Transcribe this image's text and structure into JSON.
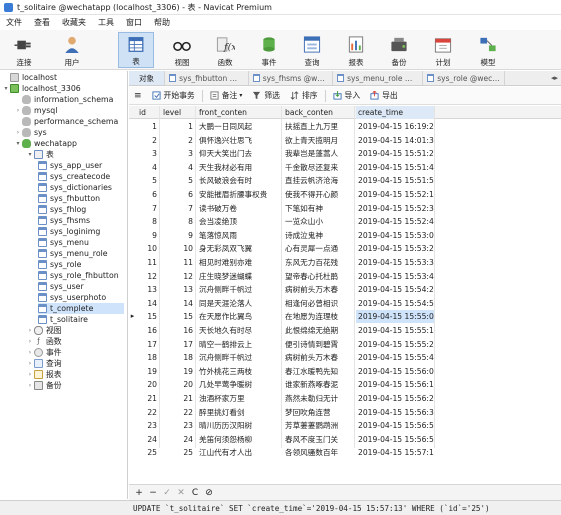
{
  "window": {
    "title": "t_solitaire @wechatapp (localhost_3306) - 表 - Navicat Premium"
  },
  "menu": [
    "文件",
    "查看",
    "收藏夹",
    "工具",
    "窗口",
    "帮助"
  ],
  "toolbar": {
    "buttons": [
      {
        "label": "连接",
        "icon": "plug-icon"
      },
      {
        "label": "用户",
        "icon": "user-icon"
      },
      {
        "label": "表",
        "icon": "table-icon"
      },
      {
        "label": "视图",
        "icon": "glasses-icon"
      },
      {
        "label": "函数",
        "icon": "function-icon"
      },
      {
        "label": "事件",
        "icon": "event-icon"
      },
      {
        "label": "查询",
        "icon": "query-icon"
      },
      {
        "label": "报表",
        "icon": "report-icon"
      },
      {
        "label": "备份",
        "icon": "backup-icon"
      },
      {
        "label": "计划",
        "icon": "calendar-icon"
      },
      {
        "label": "模型",
        "icon": "model-icon"
      }
    ],
    "active": "表"
  },
  "sidebar": {
    "items": [
      {
        "label": "localhost",
        "icon": "server",
        "twisty": ""
      },
      {
        "label": "localhost_3306",
        "icon": "server-on",
        "twisty": "▾"
      },
      {
        "label": "information_schema",
        "icon": "db",
        "twisty": ""
      },
      {
        "label": "mysql",
        "icon": "db",
        "twisty": "›"
      },
      {
        "label": "performance_schema",
        "icon": "db",
        "twisty": ""
      },
      {
        "label": "sys",
        "icon": "db",
        "twisty": "›"
      },
      {
        "label": "wechatapp",
        "icon": "db-on",
        "twisty": "▾"
      },
      {
        "label": "表",
        "icon": "tables",
        "twisty": "▾"
      },
      {
        "label": "sys_app_user",
        "icon": "table",
        "twisty": ""
      },
      {
        "label": "sys_createcode",
        "icon": "table",
        "twisty": ""
      },
      {
        "label": "sys_dictionaries",
        "icon": "table",
        "twisty": ""
      },
      {
        "label": "sys_fhbutton",
        "icon": "table",
        "twisty": ""
      },
      {
        "label": "sys_fhlog",
        "icon": "table",
        "twisty": ""
      },
      {
        "label": "sys_fhsms",
        "icon": "table",
        "twisty": ""
      },
      {
        "label": "sys_loginimg",
        "icon": "table",
        "twisty": ""
      },
      {
        "label": "sys_menu",
        "icon": "table",
        "twisty": ""
      },
      {
        "label": "sys_menu_role",
        "icon": "table",
        "twisty": ""
      },
      {
        "label": "sys_role",
        "icon": "table",
        "twisty": ""
      },
      {
        "label": "sys_role_fhbutton",
        "icon": "table",
        "twisty": ""
      },
      {
        "label": "sys_user",
        "icon": "table",
        "twisty": ""
      },
      {
        "label": "sys_userphoto",
        "icon": "table",
        "twisty": ""
      },
      {
        "label": "t_complete",
        "icon": "table",
        "twisty": "",
        "selected": true
      },
      {
        "label": "t_solitaire",
        "icon": "table",
        "twisty": ""
      },
      {
        "label": "视图",
        "icon": "view",
        "twisty": "›"
      },
      {
        "label": "函数",
        "icon": "func",
        "twisty": "›"
      },
      {
        "label": "事件",
        "icon": "event",
        "twisty": "›"
      },
      {
        "label": "查询",
        "icon": "query",
        "twisty": "›"
      },
      {
        "label": "报表",
        "icon": "report",
        "twisty": "›"
      },
      {
        "label": "备份",
        "icon": "backup",
        "twisty": "›"
      }
    ]
  },
  "tabs": [
    {
      "label": "对象"
    },
    {
      "label": "sys_fhbutton @we..."
    },
    {
      "label": "sys_fhsms @wechat..."
    },
    {
      "label": "sys_menu_role @we..."
    },
    {
      "label": "sys_role @wecha..."
    }
  ],
  "grid_toolbar": {
    "begin_transaction": "开始事务",
    "memo": "备注",
    "filter": "筛选",
    "sort": "排序",
    "import": "导入",
    "export": "导出"
  },
  "table": {
    "columns": [
      "id",
      "level",
      "front_conten",
      "back_conten",
      "create_time"
    ],
    "current_row_index": 14,
    "rows": [
      [
        "1",
        "1",
        "大鹏一日同风起",
        "扶摇直上九万里",
        "2019-04-15 16:19:21"
      ],
      [
        "2",
        "2",
        "俱怀逸兴壮思飞",
        "欲上青天揽明月",
        "2019-04-15 14:01:38"
      ],
      [
        "3",
        "3",
        "仰天大笑出门去",
        "我辈岂是蓬蒿人",
        "2019-04-15 15:51:29"
      ],
      [
        "4",
        "4",
        "天生我材必有用",
        "千金散尽还复来",
        "2019-04-15 15:51:49"
      ],
      [
        "5",
        "5",
        "长风破浪会有时",
        "直挂云帆济沧海",
        "2019-04-15 15:51:51"
      ],
      [
        "6",
        "6",
        "安能摧眉折腰事权贵",
        "使我不得开心颜",
        "2019-04-15 15:52:18"
      ],
      [
        "7",
        "7",
        "读书破万卷",
        "下笔如有神",
        "2019-04-15 15:52:30"
      ],
      [
        "8",
        "8",
        "会当凌绝顶",
        "一览众山小",
        "2019-04-15 15:52:49"
      ],
      [
        "9",
        "9",
        "笔落惊风雨",
        "诗成泣鬼神",
        "2019-04-15 15:53:01"
      ],
      [
        "10",
        "10",
        "身无彩凤双飞翼",
        "心有灵犀一点通",
        "2019-04-15 15:53:23"
      ],
      [
        "11",
        "11",
        "相见时难别亦难",
        "东风无力百花残",
        "2019-04-15 15:53:34"
      ],
      [
        "12",
        "12",
        "庄生晓梦迷蝴蝶",
        "望帝春心托杜鹃",
        "2019-04-15 15:53:45"
      ],
      [
        "13",
        "13",
        "沉舟侧畔千帆过",
        "病树前头万木春",
        "2019-04-15 15:54:23"
      ],
      [
        "14",
        "14",
        "同是天涯沦落人",
        "相逢何必曾相识",
        "2019-04-15 15:54:56"
      ],
      [
        "15",
        "15",
        "在天愿作比翼鸟",
        "在地愿为连理枝",
        "2019-04-15 15:55:06"
      ],
      [
        "16",
        "16",
        "天长地久有时尽",
        "此恨绵绵无绝期",
        "2019-04-15 15:55:18"
      ],
      [
        "17",
        "17",
        "晴空一鹤排云上",
        "便引诗情到碧霄",
        "2019-04-15 15:55:27"
      ],
      [
        "18",
        "18",
        "沉舟侧畔千帆过",
        "病树前头万木春",
        "2019-04-15 15:55:47"
      ],
      [
        "19",
        "19",
        "竹外桃花三两枝",
        "春江水暖鸭先知",
        "2019-04-15 15:56:02"
      ],
      [
        "20",
        "20",
        "几处早莺争暖树",
        "谁家新燕啄春泥",
        "2019-04-15 15:56:12"
      ],
      [
        "21",
        "21",
        "浊酒杯家万里",
        "燕然未勒归无计",
        "2019-04-15 15:56:20"
      ],
      [
        "22",
        "22",
        "醉里挑灯看剑",
        "梦回吹角连营",
        "2019-04-15 15:56:38"
      ],
      [
        "23",
        "23",
        "晴川历历汉阳树",
        "芳草萋萋鹦鹉洲",
        "2019-04-15 15:56:54"
      ],
      [
        "24",
        "24",
        "羌笛何须怨杨柳",
        "春风不度玉门关",
        "2019-04-15 15:56:57"
      ],
      [
        "25",
        "25",
        "江山代有才人出",
        "各领风骚数百年",
        "2019-04-15 15:57:13"
      ]
    ]
  },
  "navbar": [
    "+",
    "−",
    "✓",
    "✕",
    "C",
    "⊘"
  ],
  "status": {
    "sql": "UPDATE `t_solitaire` SET `create_time`='2019-04-15 15:57:13' WHERE (`id`='25')"
  }
}
